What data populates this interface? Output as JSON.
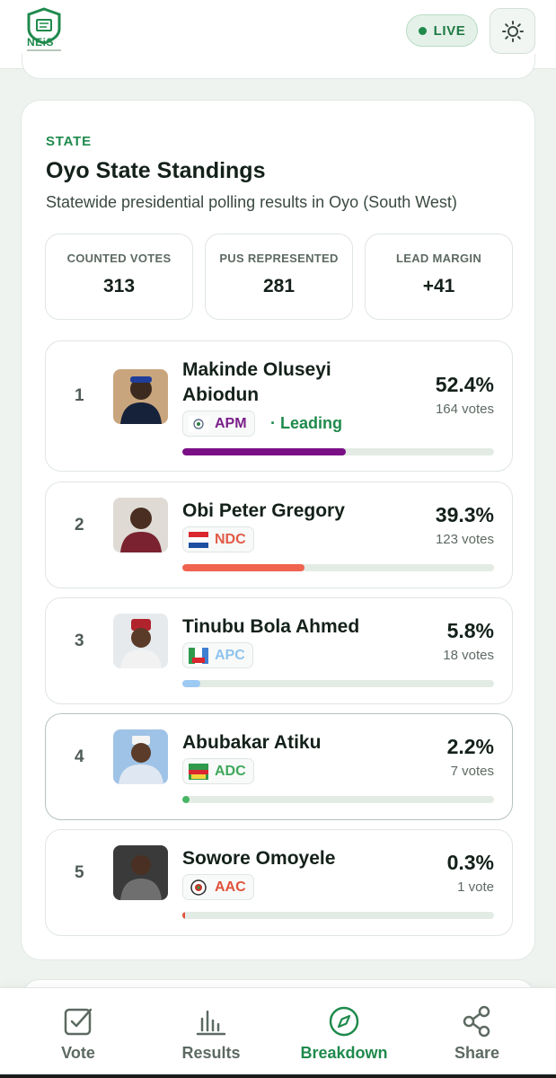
{
  "header": {
    "logo_text": "NEiS",
    "live_label": "LIVE"
  },
  "state": {
    "eyebrow": "STATE",
    "title": "Oyo State Standings",
    "subtitle": "Statewide presidential polling results in Oyo (South West)",
    "stats": [
      {
        "label": "COUNTED VOTES",
        "value": "313"
      },
      {
        "label": "PUS REPRESENTED",
        "value": "281"
      },
      {
        "label": "LEAD MARGIN",
        "value": "+41"
      }
    ],
    "candidates": [
      {
        "rank": "1",
        "name_line1": "Makinde Oluseyi",
        "name_line2": "Abiodun",
        "party": "APM",
        "party_color": "#7a1f8a",
        "bar_color": "#7a0f86",
        "status": "· Leading",
        "pct": "52.4%",
        "votes": "164 votes",
        "share": 0.524
      },
      {
        "rank": "2",
        "name_line1": "Obi Peter Gregory",
        "name_line2": "",
        "party": "NDC",
        "party_color": "#e25a45",
        "bar_color": "#f0634f",
        "status": "",
        "pct": "39.3%",
        "votes": "123 votes",
        "share": 0.393
      },
      {
        "rank": "3",
        "name_line1": "Tinubu Bola Ahmed",
        "name_line2": "",
        "party": "APC",
        "party_color": "#8fc3ee",
        "bar_color": "#9ccaf3",
        "status": "",
        "pct": "5.8%",
        "votes": "18 votes",
        "share": 0.058
      },
      {
        "rank": "4",
        "name_line1": "Abubakar Atiku",
        "name_line2": "",
        "party": "ADC",
        "party_color": "#3fa85c",
        "bar_color": "#48b565",
        "status": "",
        "pct": "2.2%",
        "votes": "7 votes",
        "share": 0.022
      },
      {
        "rank": "5",
        "name_line1": "Sowore Omoyele",
        "name_line2": "",
        "party": "AAC",
        "party_color": "#e0523c",
        "bar_color": "#e0523c",
        "status": "",
        "pct": "0.3%",
        "votes": "1 vote",
        "share": 0.003
      }
    ]
  },
  "nav": {
    "items": [
      {
        "label": "Vote",
        "icon": "checkbox-icon"
      },
      {
        "label": "Results",
        "icon": "bar-chart-icon"
      },
      {
        "label": "Breakdown",
        "icon": "compass-icon"
      },
      {
        "label": "Share",
        "icon": "share-icon"
      }
    ],
    "active": "Breakdown"
  },
  "colors": {
    "accent": "#1f8a4c",
    "background": "#eef3ef"
  }
}
